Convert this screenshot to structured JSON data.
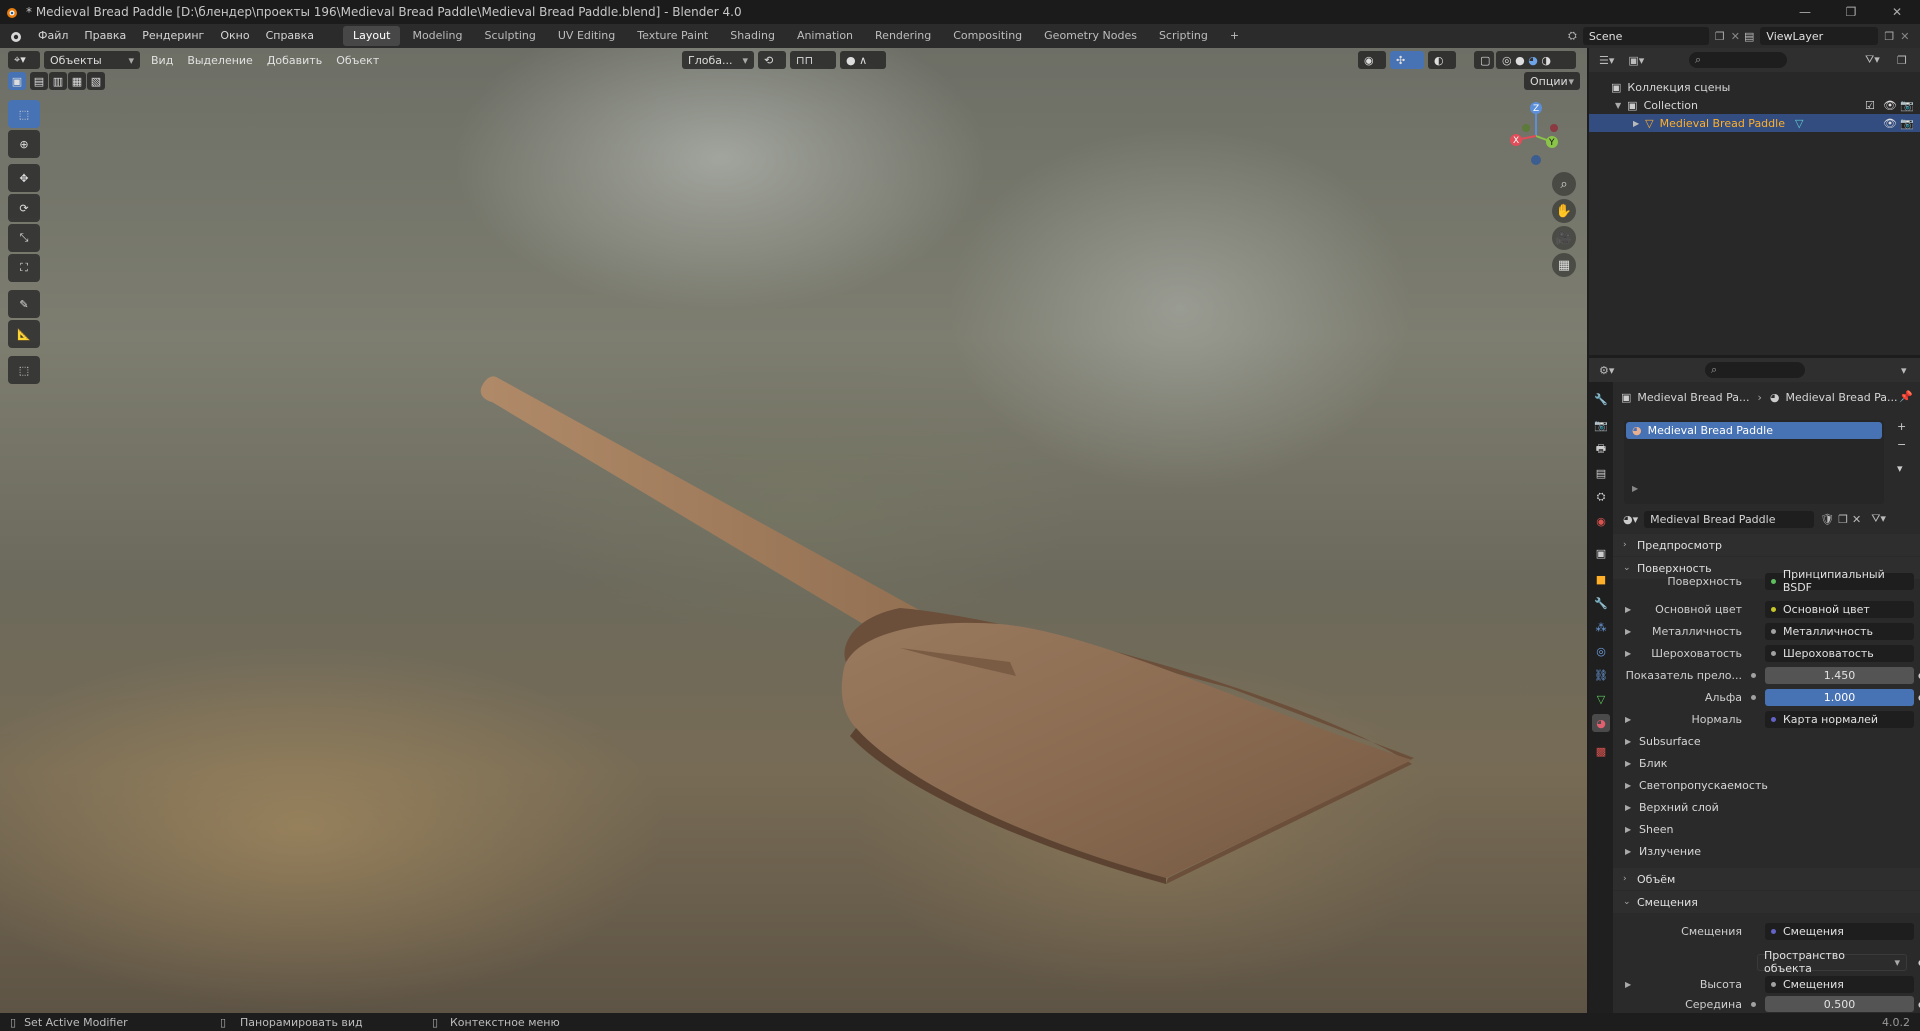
{
  "window": {
    "title": "* Medieval Bread Paddle [D:\\блендер\\проекты 196\\Medieval Bread Paddle\\Medieval Bread Paddle.blend] - Blender 4.0"
  },
  "menu": [
    "Файл",
    "Правка",
    "Рендеринг",
    "Окно",
    "Справка"
  ],
  "workspaces": {
    "active": "Layout",
    "tabs": [
      "Layout",
      "Modeling",
      "Sculpting",
      "UV Editing",
      "Texture Paint",
      "Shading",
      "Animation",
      "Rendering",
      "Compositing",
      "Geometry Nodes",
      "Scripting"
    ],
    "add": "+"
  },
  "scene": {
    "name": "Scene",
    "view_layer": "ViewLayer"
  },
  "viewport": {
    "mode": "Объекты",
    "menus": [
      "Вид",
      "Выделение",
      "Добавить",
      "Объект"
    ],
    "transform_orientation": "Глоба...",
    "options": "Опции",
    "gizmo": {
      "x": "X",
      "y": "Y",
      "z": "Z"
    }
  },
  "outliner": {
    "root": "Коллекция сцены",
    "collection": "Collection",
    "object": "Medieval Bread Paddle"
  },
  "properties": {
    "breadcrumb_object": "Medieval Bread Pa...",
    "breadcrumb_material": "Medieval Bread Pa...",
    "material_slot": "Medieval Bread Paddle",
    "material_name": "Medieval Bread Paddle",
    "panels": {
      "preview": "Предпросмотр",
      "surface": "Поверхность",
      "volume": "Объём",
      "displacement": "Смещения"
    },
    "surface_rows": [
      {
        "label": "Поверхность",
        "value": "Принципиальный BSDF",
        "dot": "#5fbf5f"
      },
      {
        "label": "Основной цвет",
        "value": "Основной цвет",
        "dot": "#c7c729"
      },
      {
        "label": "Металличность",
        "value": "Металличность",
        "dot": "#a1a1a1"
      },
      {
        "label": "Шероховатость",
        "value": "Шероховатость",
        "dot": "#a1a1a1"
      },
      {
        "label": "Показатель прело...",
        "value": "1.450",
        "dot": "#a1a1a1"
      },
      {
        "label": "Альфа",
        "value": "1.000",
        "dot": "#a1a1a1"
      },
      {
        "label": "Нормаль",
        "value": "Карта нормалей",
        "dot": "#6363c7"
      }
    ],
    "subpanels": [
      "Subsurface",
      "Блик",
      "Светопропускаемость",
      "Верхний слой",
      "Sheen",
      "Излучение"
    ],
    "displacement_rows": [
      {
        "label": "Смещения",
        "value": "Смещения",
        "dot": "#6363c7"
      },
      {
        "label": "",
        "value": "Пространство объекта"
      },
      {
        "label": "Высота",
        "value": "Смещения",
        "dot": "#a1a1a1"
      },
      {
        "label": "Середина",
        "value": "0.500",
        "dot": "#a1a1a1"
      }
    ]
  },
  "status": {
    "left": "Set Active Modifier",
    "middle": "Панорамировать вид",
    "right": "Контекстное меню",
    "version": "4.0.2"
  },
  "colors": {
    "accent": "#4772b3",
    "active_object": "#ffaf29"
  }
}
